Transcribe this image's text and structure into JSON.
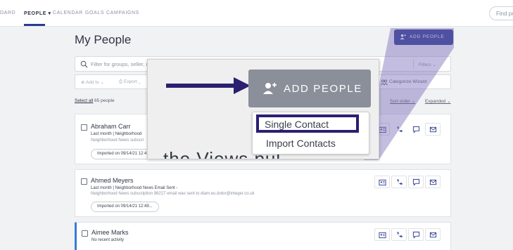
{
  "nav": {
    "items": [
      {
        "label": "DARD"
      },
      {
        "label": "PEOPLE ▾"
      },
      {
        "label": "CALENDAR"
      },
      {
        "label": "GOALS"
      },
      {
        "label": "CAMPAIGNS"
      }
    ],
    "find_placeholder": "Find peo"
  },
  "page": {
    "title": "My People"
  },
  "header": {
    "add_people_label": "ADD PEOPLE"
  },
  "search": {
    "placeholder": "Filter for groups, seller, n",
    "filters_label": "Filters ⌄"
  },
  "toolbar": {
    "add_to_label": "⊕ Add to ⌄",
    "export_label": "⎙ Export ⌄",
    "wizard_label": "Categorize Wizard"
  },
  "list_controls": {
    "select_all": "Select all",
    "count": "65 people",
    "sort_order": "Sort order ⌄",
    "expanded": "Expanded ⌄"
  },
  "contacts": [
    {
      "name": "Abraham Carr",
      "meta": "Last month | Neighborhood",
      "meta2": "Neighborhood News subscri",
      "imported": "Imported on 09/14/21 12:4"
    },
    {
      "name": "Ahmed Meyers",
      "meta": "Last month | Neighborhood News Email Sent -",
      "meta2": "Neighborhood News subscription 98227 email was sent to diam.eu.dolor@integer.co.uk",
      "imported": "Imported on 09/14/21 12:49..."
    },
    {
      "name": "Aimee Marks",
      "meta": "No recent activity"
    }
  ],
  "callout": {
    "add_people_label": "ADD PEOPLE",
    "menu": [
      {
        "label": "Single Contact"
      },
      {
        "label": "Import Contacts"
      }
    ],
    "background_text": "the Views pul"
  },
  "colors": {
    "brand": "#2b3a8f",
    "highlight_border": "#2b1f72",
    "overlay": "#7a6db8",
    "active_card": "#3d7bd9"
  }
}
